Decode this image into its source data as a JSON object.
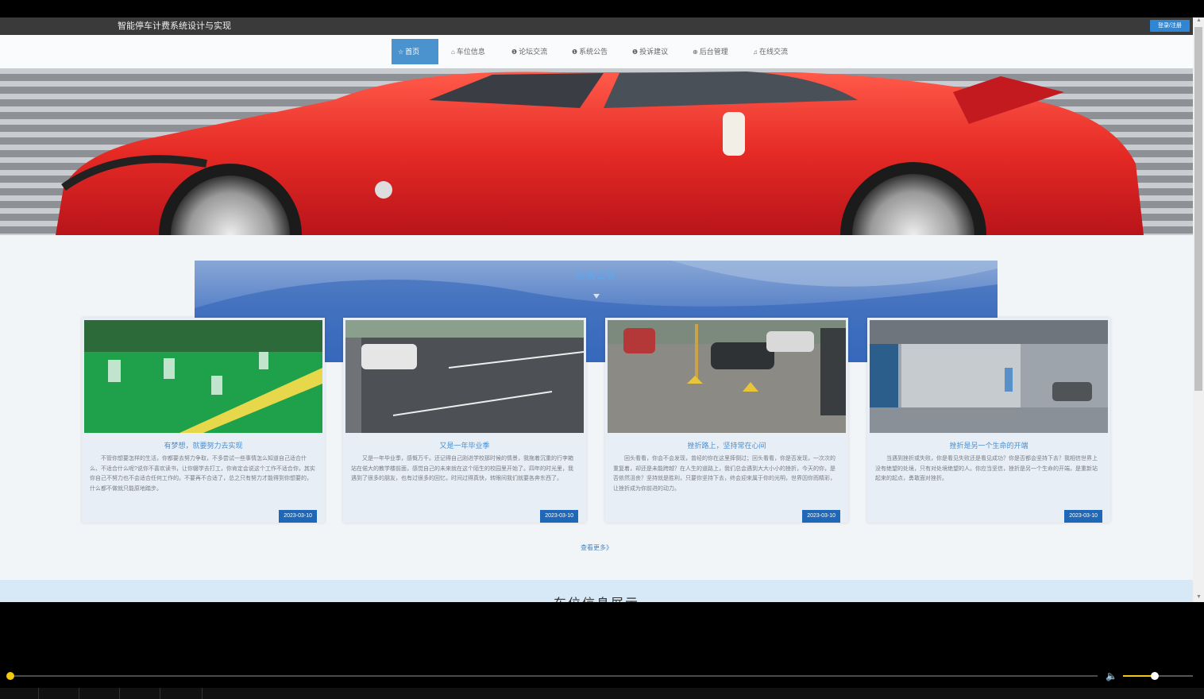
{
  "app": {
    "title": "智能停车计费系统设计与实现",
    "login_label": "登录/注册"
  },
  "nav": {
    "items": [
      {
        "icon": "☆",
        "label": "首页",
        "active": true
      },
      {
        "icon": "⌂",
        "label": "车位信息",
        "active": false
      },
      {
        "icon": "❶",
        "label": "论坛交流",
        "active": false
      },
      {
        "icon": "❶",
        "label": "系统公告",
        "active": false
      },
      {
        "icon": "❶",
        "label": "投诉建议",
        "active": false
      },
      {
        "icon": "⊕",
        "label": "后台管理",
        "active": false
      },
      {
        "icon": "♫",
        "label": "在线交流",
        "active": false
      }
    ]
  },
  "carousel": {
    "slide_count": 3,
    "active_index": 0
  },
  "notices": {
    "title": "系统公告",
    "cards": [
      {
        "title": "有梦想，就要努力去实现",
        "text": "不管你想要怎样的生活，你都要去努力争取，不多尝试一些事情怎么知道自己适合什么、不适合什么呢?说你不喜欢读书，让你辍学去打工，你肯定会说这个工作不适合你，其实你自己不努力也不会适合任何工作的。不要再不合适了，总之只有努力才能得到你想要的，什么都不做就只能原地踏步。",
        "date": "2023-03-10"
      },
      {
        "title": "又是一年毕业季",
        "text": "又是一年毕业季，感慨万千。还记得自己刚进学校那时候的情景，我拖着沉重的行李箱站在偌大的教学楼前面，感觉自己的未来就在这个陌生的校园里开始了。四年的时光里，我遇到了很多的朋友，也有过很多的回忆，时间过得真快，转眼间我们就要各奔东西了。",
        "date": "2023-03-10"
      },
      {
        "title": "挫折路上，坚持常在心间",
        "text": "回头看看，你会不会发现，曾经的你在这里摔倒过；回头看看，你是否发现，一次次的重复着，却还是未能跨越？在人生的道路上，我们总会遇到大大小小的挫折，今天的你，是否依然沮丧？坚持就是胜利，只要你坚持下去，终会迎来属于你的光明，世界因你而精彩，让挫折成为你前进的动力。",
        "date": "2023-03-10"
      },
      {
        "title": "挫折是另一个生命的开端",
        "text": "当遇到挫折或失败，你是看见失败还是看见成功？你是否都会坚持下去？我相信世界上没有绝望的处境，只有对处境绝望的人。你应当坚信，挫折是另一个生命的开端，是重新站起来的起点，勇敢面对挫折。",
        "date": "2023-03-10"
      }
    ],
    "more_label": "查看更多》"
  },
  "parking_section": {
    "title": "车位信息展示"
  },
  "scrollbar": {
    "up": "▲",
    "down": "▼"
  },
  "player": {
    "progress": 0.0,
    "volume": 0.45,
    "volume_icon": "speaker-icon"
  },
  "colors": {
    "accent": "#4a93cf",
    "date_badge": "#1f68b8",
    "topbar": "#3a3a3a",
    "player_accent": "#f2c811"
  }
}
